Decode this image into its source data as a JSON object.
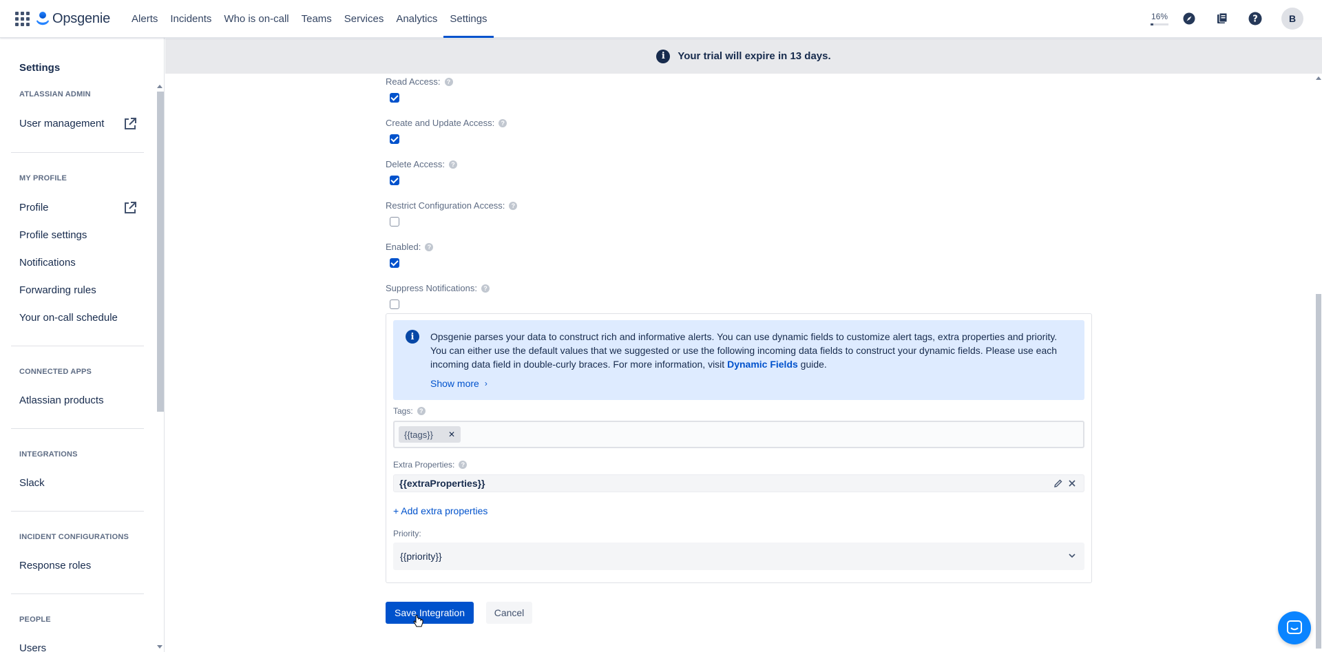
{
  "app": {
    "logo_text": "Opsgenie"
  },
  "topnav": {
    "items": [
      {
        "label": "Alerts"
      },
      {
        "label": "Incidents"
      },
      {
        "label": "Who is on-call"
      },
      {
        "label": "Teams"
      },
      {
        "label": "Services"
      },
      {
        "label": "Analytics"
      },
      {
        "label": "Settings",
        "active": true
      }
    ],
    "trial_percent_label": "16%",
    "trial_percent": 16,
    "avatar_initial": "B",
    "icons": [
      "app-switcher-icon",
      "compass-icon",
      "book-icon",
      "help-icon"
    ]
  },
  "banner": {
    "text": "Your trial will expire in 13 days."
  },
  "sidebar": {
    "title": "Settings",
    "sections": [
      {
        "heading": "ATLASSIAN ADMIN",
        "items": [
          {
            "label": "User management",
            "external": true
          }
        ]
      },
      {
        "heading": "MY PROFILE",
        "items": [
          {
            "label": "Profile",
            "external": true
          },
          {
            "label": "Profile settings"
          },
          {
            "label": "Notifications"
          },
          {
            "label": "Forwarding rules"
          },
          {
            "label": "Your on-call schedule"
          }
        ]
      },
      {
        "heading": "CONNECTED APPS",
        "items": [
          {
            "label": "Atlassian products"
          }
        ]
      },
      {
        "heading": "INTEGRATIONS",
        "items": [
          {
            "label": "Slack"
          }
        ]
      },
      {
        "heading": "INCIDENT CONFIGURATIONS",
        "items": [
          {
            "label": "Response roles"
          }
        ]
      },
      {
        "heading": "PEOPLE",
        "items": [
          {
            "label": "Users"
          }
        ]
      }
    ]
  },
  "form": {
    "fields": [
      {
        "label": "Read Access:",
        "checked": true
      },
      {
        "label": "Create and Update Access:",
        "checked": true
      },
      {
        "label": "Delete Access:",
        "checked": true
      },
      {
        "label": "Restrict Configuration Access:",
        "checked": false
      },
      {
        "label": "Enabled:",
        "checked": true
      },
      {
        "label": "Suppress Notifications:",
        "checked": false
      }
    ],
    "info": {
      "text_before_link": "Opsgenie parses your data to construct rich and informative alerts. You can use dynamic fields to customize alert tags, extra properties and priority. You can either use the default values that we suggested or use the following incoming data fields to construct your dynamic fields. Please use each incoming data field in double-curly braces. For more information, visit ",
      "link_text": "Dynamic Fields",
      "text_after_link": " guide.",
      "show_more": "Show more"
    },
    "tags": {
      "label": "Tags:",
      "values": [
        "{{tags}}"
      ]
    },
    "extra_properties": {
      "label": "Extra Properties:",
      "value": "{{extraProperties}}",
      "add_label": "+ Add extra properties"
    },
    "priority": {
      "label": "Priority:",
      "value": "{{priority}}"
    },
    "save_label": "Save Integration",
    "cancel_label": "Cancel"
  },
  "colors": {
    "primary": "#0052cc",
    "info_bg": "#deebff",
    "banner_bg": "#e8e9ec",
    "chat": "#0a84ff"
  }
}
